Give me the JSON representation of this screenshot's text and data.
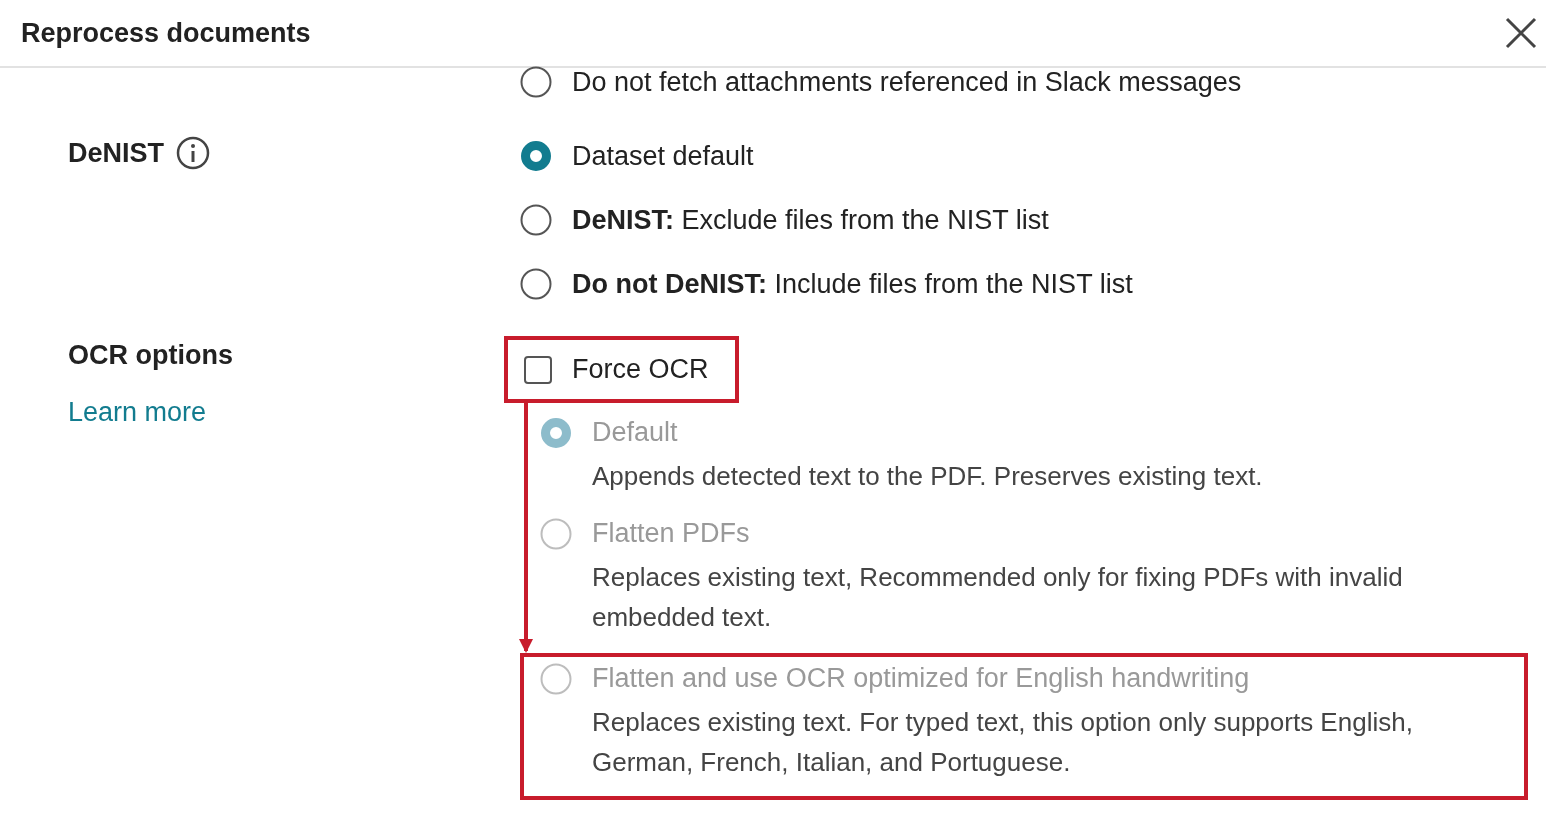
{
  "dialog": {
    "title": "Reprocess documents"
  },
  "slack_option": {
    "label": "Do not fetch attachments referenced in Slack messages",
    "selected": false
  },
  "sections": [
    {
      "label": "DeNIST",
      "info": true,
      "kind": "radio",
      "options": [
        {
          "label": "Dataset default",
          "selected": true
        },
        {
          "bold": "DeNIST:",
          "label": "Exclude files from the NIST list",
          "selected": false
        },
        {
          "bold": "Do not DeNIST:",
          "label": "Include files from the NIST list",
          "selected": false
        }
      ]
    },
    {
      "label": "OCR options",
      "info": false,
      "link": "Learn more",
      "kind": "ocr",
      "force": {
        "label": "Force OCR",
        "checked": false,
        "highlighted": true
      },
      "options": [
        {
          "label": "Default",
          "description": "Appends detected text to the PDF. Preserves existing text.",
          "selected": true,
          "disabled": true,
          "highlighted": false
        },
        {
          "label": "Flatten PDFs",
          "description": "Replaces existing text, Recommended only for fixing PDFs with invalid embedded text.",
          "selected": false,
          "disabled": true,
          "highlighted": false
        },
        {
          "label": "Flatten and use OCR optimized for English handwriting",
          "description": "Replaces existing text. For typed text, this option only supports English, German, French, Italian, and Portuguese.",
          "selected": false,
          "disabled": true,
          "highlighted": true
        }
      ]
    }
  ]
}
